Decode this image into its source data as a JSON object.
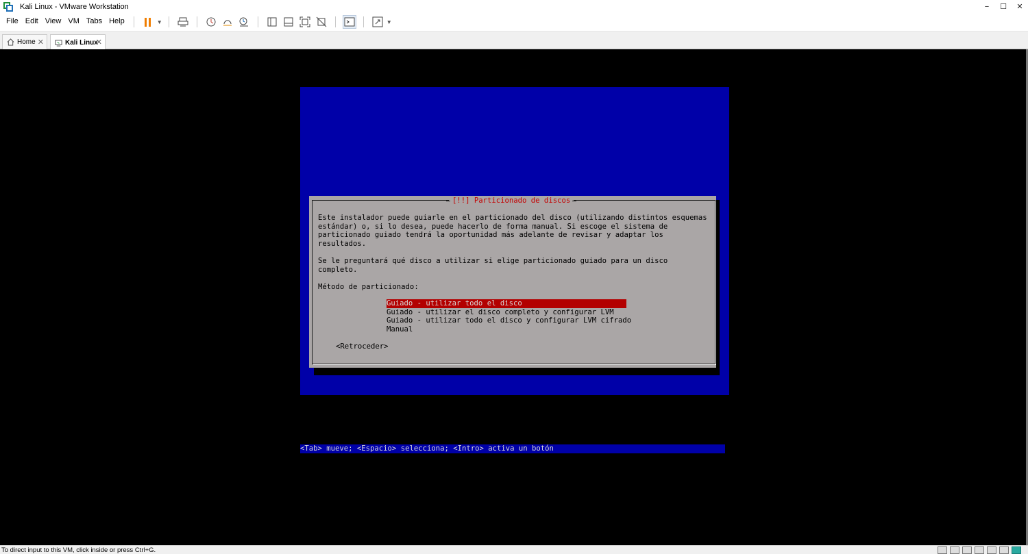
{
  "window": {
    "title": "Kali Linux - VMware Workstation",
    "controls": {
      "minimize": "−",
      "maximize": "☐",
      "close": "✕"
    }
  },
  "menu": {
    "items": [
      "File",
      "Edit",
      "View",
      "VM",
      "Tabs",
      "Help"
    ]
  },
  "toolbar": {
    "icons": [
      "pause-icon",
      "send-ctrl-alt-del-icon",
      "snapshot-icon",
      "revert-snapshot-icon",
      "snapshot-manager-icon",
      "show-library-icon",
      "thumbnail-bar-icon",
      "full-screen-icon",
      "unity-icon",
      "console-view-icon",
      "stretch-guest-icon"
    ],
    "accent_color": "#f07d00"
  },
  "tabs": [
    {
      "label": "Home",
      "active": false
    },
    {
      "label": "Kali Linux",
      "active": true
    }
  ],
  "installer": {
    "title": "[!!] Particionado de discos",
    "paragraph1": "Este instalador puede guiarle en el particionado del disco (utilizando distintos esquemas\nestándar) o, si lo desea, puede hacerlo de forma manual. Si escoge el sistema de\nparticionado guiado tendrá la oportunidad más adelante de revisar y adaptar los\nresultados.",
    "paragraph2": "Se le preguntará qué disco a utilizar si elige particionado guiado para un disco\ncompleto.",
    "method_label": "Método de particionado:",
    "options": [
      "Guiado - utilizar todo el disco",
      "Guiado - utilizar el disco completo y configurar LVM",
      "Guiado - utilizar todo el disco y configurar LVM cifrado",
      "Manual"
    ],
    "selected_index": 0,
    "back_button": "<Retroceder>",
    "help": "<Tab> mueve; <Espacio> selecciona; <Intro> activa un botón",
    "colors": {
      "background": "#0000a8",
      "dialog": "#aaa6a6",
      "highlight": "#b30000",
      "title": "#c40000"
    }
  },
  "statusbar": {
    "text": "To direct input to this VM, click inside or press Ctrl+G."
  }
}
